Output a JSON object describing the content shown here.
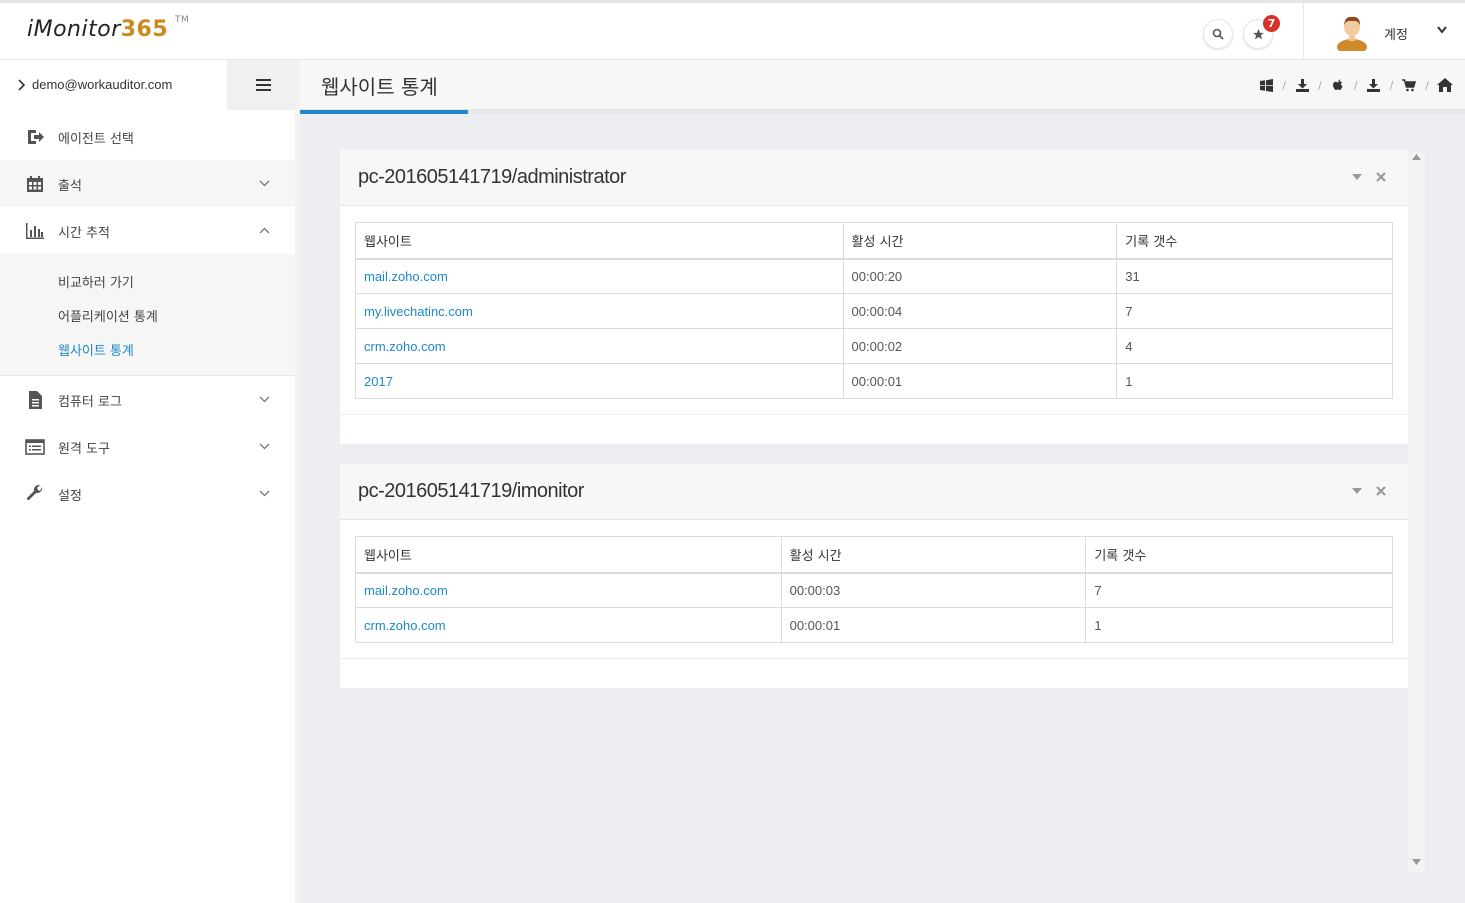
{
  "app": {
    "logo_text": "iMonitor",
    "logo_num": "365",
    "logo_tm": "TM"
  },
  "header": {
    "notification_count": "7",
    "account_label": "계정"
  },
  "sidebar": {
    "user_email": "demo@workauditor.com",
    "items": [
      {
        "label": "에이전트 선택",
        "icon": "sign-in-icon"
      },
      {
        "label": "출석",
        "icon": "calendar-icon"
      },
      {
        "label": "시간 추적",
        "icon": "bar-chart-icon"
      },
      {
        "label": "컴퓨터 로그",
        "icon": "file-icon"
      },
      {
        "label": "원격 도구",
        "icon": "list-icon"
      },
      {
        "label": "설정",
        "icon": "wrench-icon"
      }
    ],
    "submenu": [
      {
        "label": "비교하러 가기"
      },
      {
        "label": "어플리케이션 통계"
      },
      {
        "label": "웹사이트 통계"
      }
    ]
  },
  "page": {
    "title": "웹사이트 통계",
    "breadcrumb_icons": [
      "windows-icon",
      "download-icon",
      "apple-icon",
      "download-icon",
      "cart-icon",
      "home-icon"
    ]
  },
  "panels": [
    {
      "title": "pc-201605141719/administrator",
      "headers": [
        "웹사이트",
        "활성 시간",
        "기록 갯수"
      ],
      "rows": [
        [
          "mail.zoho.com",
          "00:00:20",
          "31"
        ],
        [
          "my.livechatinc.com",
          "00:00:04",
          "7"
        ],
        [
          "crm.zoho.com",
          "00:00:02",
          "4"
        ],
        [
          "2017",
          "00:00:01",
          "1"
        ]
      ]
    },
    {
      "title": "pc-201605141719/imonitor",
      "headers": [
        "웹사이트",
        "활성 시간",
        "기록 갯수"
      ],
      "rows": [
        [
          "mail.zoho.com",
          "00:00:03",
          "7"
        ],
        [
          "crm.zoho.com",
          "00:00:01",
          "1"
        ]
      ]
    }
  ],
  "colors": {
    "accent": "#1e88c8",
    "badge": "#d9302a",
    "content_bg": "#eceef1"
  }
}
